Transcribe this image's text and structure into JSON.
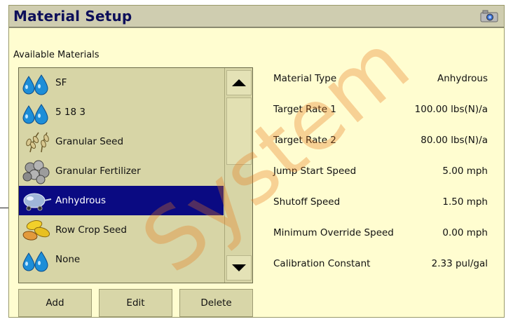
{
  "window": {
    "title": "Material Setup",
    "title_color": "#0d0f5a",
    "bg": "#fffdd0"
  },
  "header_icon": "camera-icon",
  "materials": {
    "label": "Available Materials",
    "selected_color": "#0a0a82",
    "items": [
      {
        "label": "SF",
        "icon": "liquid-drops-icon",
        "selected": false
      },
      {
        "label": "5 18 3",
        "icon": "liquid-drops-icon",
        "selected": false
      },
      {
        "label": "Granular Seed",
        "icon": "grain-seed-icon",
        "selected": false
      },
      {
        "label": "Granular Fertilizer",
        "icon": "fertilizer-pellets-icon",
        "selected": false
      },
      {
        "label": "Anhydrous",
        "icon": "anhydrous-tank-icon",
        "selected": true
      },
      {
        "label": "Row Crop Seed",
        "icon": "row-crop-seed-icon",
        "selected": false
      },
      {
        "label": "None",
        "icon": "liquid-drops-icon",
        "selected": false
      }
    ]
  },
  "properties": [
    {
      "label": "Material Type",
      "value": "Anhydrous"
    },
    {
      "label": "Target Rate 1",
      "value": "100.00 lbs(N)/a"
    },
    {
      "label": "Target Rate 2",
      "value": "80.00 lbs(N)/a"
    },
    {
      "label": "Jump Start Speed",
      "value": "5.00 mph"
    },
    {
      "label": "Shutoff Speed",
      "value": "1.50 mph"
    },
    {
      "label": "Minimum Override Speed",
      "value": "0.00 mph"
    },
    {
      "label": "Calibration Constant",
      "value": "2.33 pul/gal"
    }
  ],
  "buttons": {
    "add": "Add",
    "edit": "Edit",
    "delete": "Delete"
  },
  "watermark_text": "System"
}
